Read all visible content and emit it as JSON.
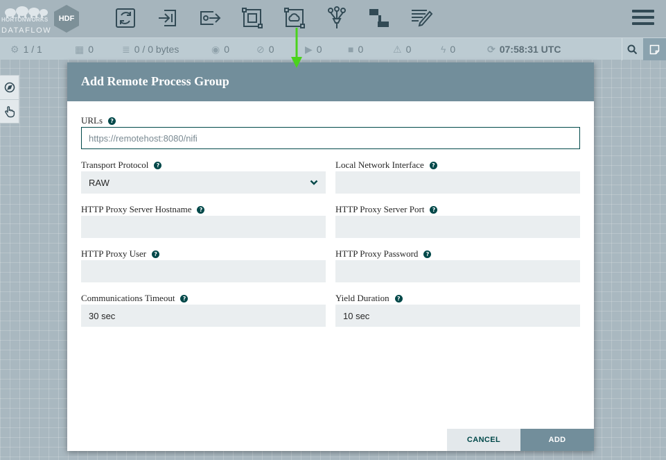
{
  "logo": {
    "vendor": "HORTONWORKS",
    "product": "DATAFLOW",
    "badge": "HDF"
  },
  "toolbar": {
    "items": [
      {
        "name": "processor",
        "icon": "processor-icon"
      },
      {
        "name": "input-port",
        "icon": "input-port-icon"
      },
      {
        "name": "output-port",
        "icon": "output-port-icon"
      },
      {
        "name": "process-group",
        "icon": "process-group-icon"
      },
      {
        "name": "remote-process-group",
        "icon": "remote-process-group-icon"
      },
      {
        "name": "funnel",
        "icon": "funnel-icon"
      },
      {
        "name": "template",
        "icon": "template-icon"
      },
      {
        "name": "label",
        "icon": "label-icon"
      }
    ],
    "menu_icon": "hamburger-menu-icon"
  },
  "status": {
    "active_threads": "1 / 1",
    "total_threads": "0",
    "queued": "0 / 0 bytes",
    "transmitting": "0",
    "not_transmitting": "0",
    "running": "0",
    "stopped": "0",
    "invalid": "0",
    "disabled": "0",
    "last_refresh": "07:58:31 UTC"
  },
  "colors": {
    "accent": "#728e9b",
    "dark_teal": "#004849",
    "drag_arrow": "#4ad31c",
    "canvas": "#a9b8c0"
  },
  "dialog": {
    "title": "Add Remote Process Group",
    "urls": {
      "label": "URLs",
      "value": "",
      "placeholder": "https://remotehost:8080/nifi"
    },
    "transport_protocol": {
      "label": "Transport Protocol",
      "value": "RAW"
    },
    "local_network_interface": {
      "label": "Local Network Interface",
      "value": ""
    },
    "http_proxy_host": {
      "label": "HTTP Proxy Server Hostname",
      "value": ""
    },
    "http_proxy_port": {
      "label": "HTTP Proxy Server Port",
      "value": ""
    },
    "http_proxy_user": {
      "label": "HTTP Proxy User",
      "value": ""
    },
    "http_proxy_password": {
      "label": "HTTP Proxy Password",
      "value": ""
    },
    "communications_timeout": {
      "label": "Communications Timeout",
      "value": "30 sec"
    },
    "yield_duration": {
      "label": "Yield Duration",
      "value": "10 sec"
    },
    "cancel_label": "CANCEL",
    "add_label": "ADD"
  }
}
